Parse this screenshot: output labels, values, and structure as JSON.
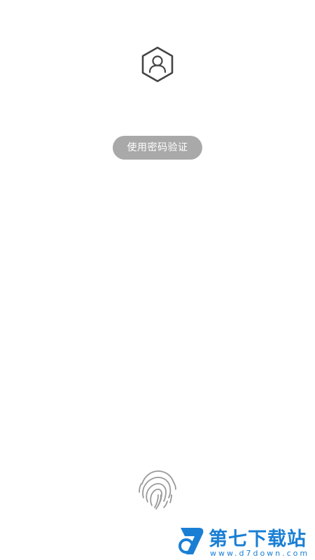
{
  "icons": {
    "avatar": "user-hexagon-icon",
    "fingerprint": "fingerprint-icon"
  },
  "auth": {
    "password_button_label": "使用密码验证"
  },
  "watermark": {
    "title": "第七下载站",
    "url": "www.d7down.com"
  },
  "colors": {
    "button_bg": "#a9a9a9",
    "icon_stroke": "#444444",
    "fingerprint_stroke": "#999999",
    "watermark_blue": "#1a7fd4"
  }
}
